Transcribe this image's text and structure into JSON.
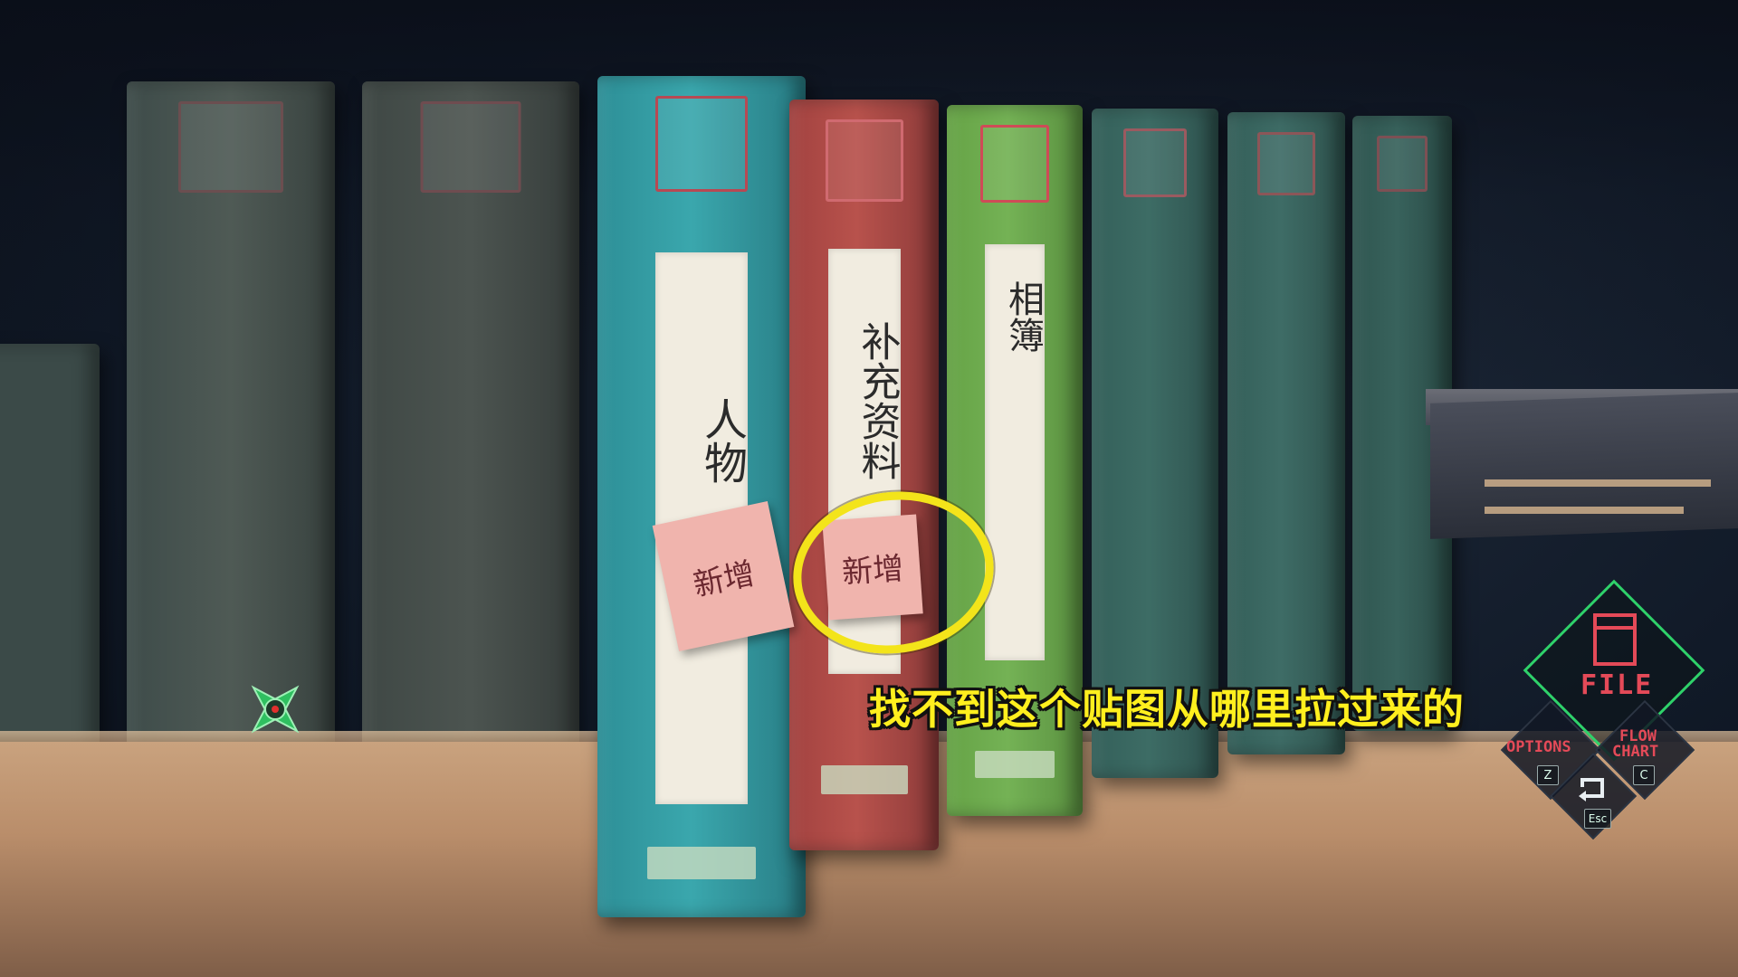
{
  "binders": [
    {
      "id": "b1",
      "label": ""
    },
    {
      "id": "b2",
      "label": ""
    },
    {
      "id": "b3",
      "label": "人物",
      "sticky": "新增"
    },
    {
      "id": "b4",
      "label": "补充资料",
      "sticky": "新增"
    },
    {
      "id": "b5",
      "label": "相簿"
    }
  ],
  "annotation": {
    "caption": "找不到这个贴图从哪里拉过来的"
  },
  "hud": {
    "file_label": "FILE",
    "options_label": "OPTIONS",
    "options_key": "Z",
    "flowchart_label_line1": "FLOW",
    "flowchart_label_line2": "CHART",
    "flowchart_key": "C",
    "back_key": "Esc"
  },
  "colors": {
    "highlight_circle": "#f3e41a",
    "caption_text": "#ffef1e",
    "hud_accent": "#2fd16a",
    "hud_text": "#e44a58"
  },
  "icons": {
    "cursor": "crosshair-star-icon",
    "file": "file-folder-icon",
    "back": "return-arrow-icon"
  }
}
